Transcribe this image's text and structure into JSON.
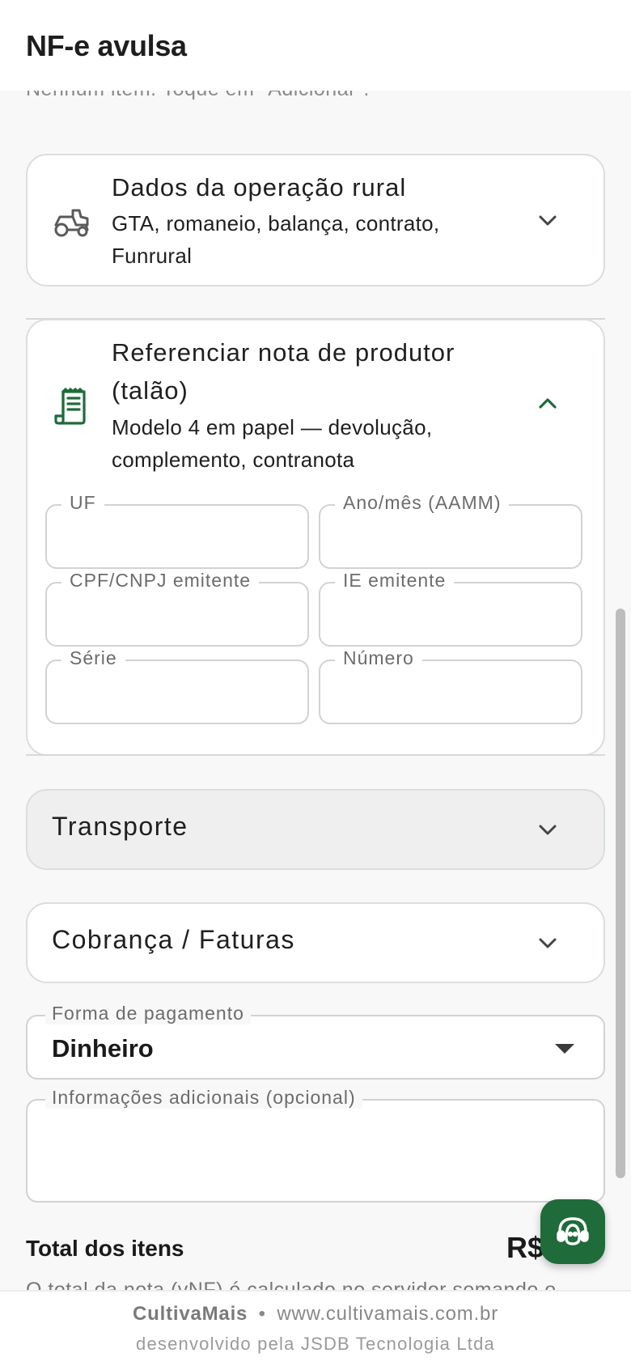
{
  "appbar": {
    "title": "NF-e avulsa"
  },
  "items_empty_hint": "Nenhum item. Toque em \"Adicionar\".",
  "rural_card": {
    "title": "Dados da operação rural",
    "subtitle": "GTA, romaneio, balança, contrato, Funrural",
    "icon": "tractor-icon",
    "expanded": false
  },
  "producer_note_card": {
    "title": "Referenciar nota de produtor (talão)",
    "subtitle": "Modelo 4 em papel — devolução, complemento, contranota",
    "icon": "receipt-icon",
    "expanded": true,
    "fields": {
      "uf": {
        "label": "UF",
        "value": ""
      },
      "ano_mes": {
        "label": "Ano/mês (AAMM)",
        "value": ""
      },
      "cpf_cnpj": {
        "label": "CPF/CNPJ emitente",
        "value": ""
      },
      "ie": {
        "label": "IE emitente",
        "value": ""
      },
      "serie": {
        "label": "Série",
        "value": ""
      },
      "numero": {
        "label": "Número",
        "value": ""
      }
    }
  },
  "transport": {
    "title": "Transporte",
    "expanded": false
  },
  "billing": {
    "title": "Cobrança / Faturas",
    "expanded": false
  },
  "payment": {
    "label": "Forma de pagamento",
    "value": "Dinheiro"
  },
  "additional_info": {
    "label": "Informações adicionais (opcional)",
    "value": ""
  },
  "totals": {
    "label": "Total dos itens",
    "value": "R$",
    "note": "O total da nota (vNF) é calculado no servidor somando o"
  },
  "support_fab": {
    "icon": "support-agent-icon"
  },
  "footer": {
    "brand": "CultivaMais",
    "separator": "•",
    "site": "www.cultivamais.com.br",
    "credit": "desenvolvido pela JSDB Tecnologia Ltda"
  },
  "colors": {
    "accent": "#1f6b3a",
    "border": "#d9dfdc",
    "background": "#f8f8f8"
  }
}
